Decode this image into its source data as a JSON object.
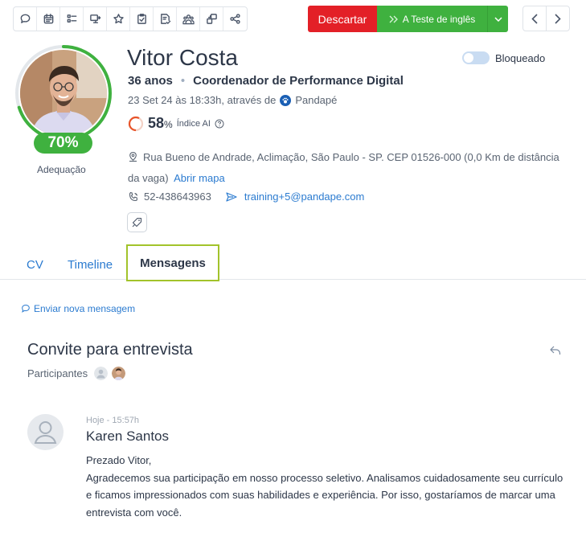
{
  "toolbar": {
    "icons": [
      "chat-icon",
      "calendar-icon",
      "checklist-icon",
      "transfer-icon",
      "star-icon",
      "clipboard-check-icon",
      "document-check-icon",
      "group-icon",
      "share-screen-icon",
      "share-icon"
    ]
  },
  "actions": {
    "discard_label": "Descartar",
    "stage_label": "A Teste de inglês"
  },
  "candidate": {
    "name": "Vitor Costa",
    "age": "36 anos",
    "role": "Coordenador de Performance Digital",
    "applied_text": "23 Set 24 às 18:33h, através de",
    "source": "Pandapé",
    "ai_score": "58",
    "ai_score_unit": "%",
    "ai_label": "Índice AI",
    "ai_score_fraction": 0.58,
    "fit_score": "70%",
    "fit_score_fraction": 0.7,
    "fit_label": "Adequação",
    "blocked_label": "Bloqueado",
    "address": "Rua Bueno de Andrade, Aclimação, São Paulo - SP. CEP 01526-000 (0,0 Km de distância da vaga)",
    "map_link": "Abrir mapa",
    "phone": "52-438643963",
    "email": "training+5@pandape.com"
  },
  "tabs": [
    {
      "label": "CV"
    },
    {
      "label": "Timeline"
    },
    {
      "label": "Mensagens",
      "active": true
    }
  ],
  "messages": {
    "new_message_label": "Enviar nova mensagem",
    "thread_title": "Convite para entrevista",
    "participants_label": "Participantes",
    "items": [
      {
        "time": "Hoje - 15:57h",
        "author": "Karen Santos",
        "body_lines": [
          "Prezado Vitor,",
          "Agradecemos sua participação em nosso processo seletivo. Analisamos cuidadosamente seu currículo e ficamos impressionados com suas habilidades e experiência. Por isso, gostaríamos de marcar uma entrevista com você."
        ]
      }
    ]
  },
  "colors": {
    "discard": "#e32027",
    "stage": "#3fb13f",
    "link": "#2b7bd0",
    "active_tab_border": "#a2c32b",
    "ai_ring": "#e8552b"
  }
}
